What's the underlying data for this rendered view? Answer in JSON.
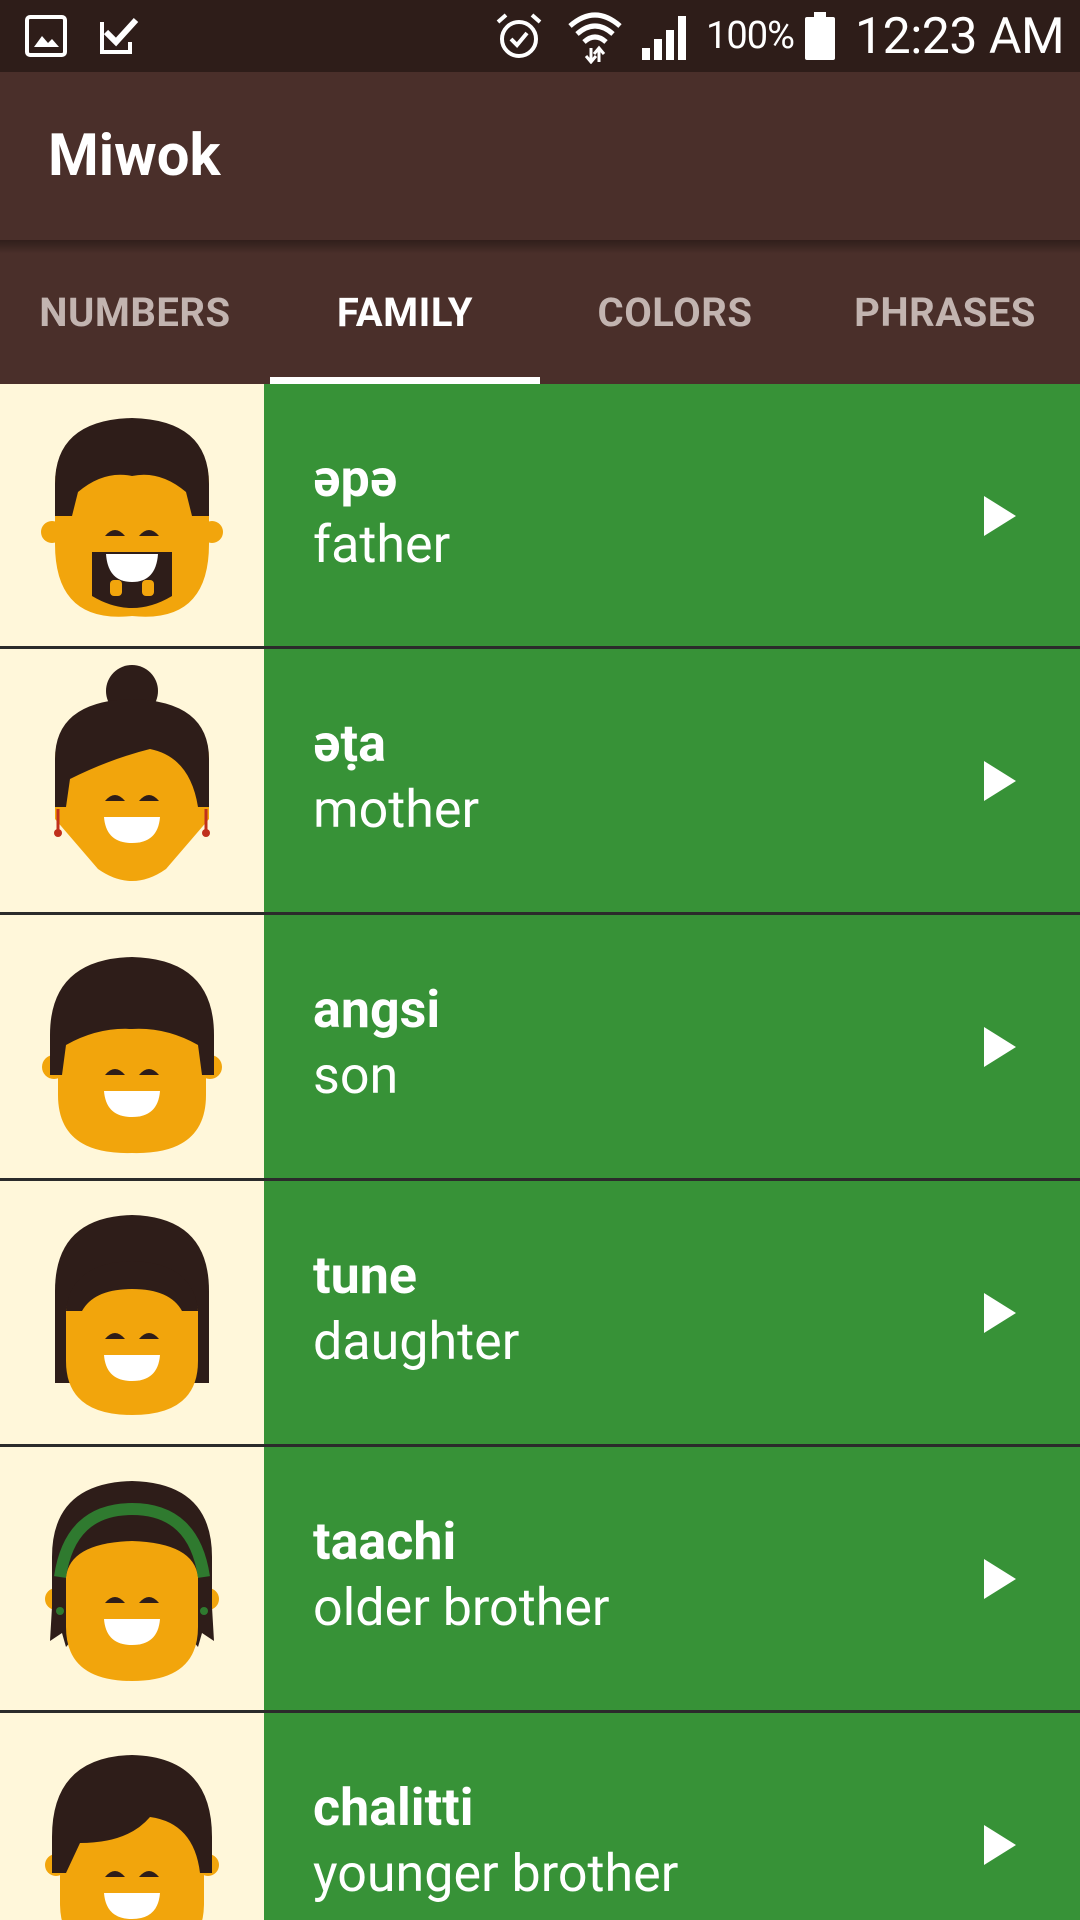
{
  "status_bar": {
    "left_icons": [
      "gallery-icon",
      "task-check-icon"
    ],
    "right_icons": [
      "alarm-icon",
      "wifi-icon",
      "signal-icon",
      "battery-icon"
    ],
    "battery": "100%",
    "time": "12:23 AM"
  },
  "app_bar": {
    "title": "Miwok"
  },
  "tabs": [
    {
      "label": "NUMBERS",
      "selected": false
    },
    {
      "label": "FAMILY",
      "selected": true
    },
    {
      "label": "COLORS",
      "selected": false
    },
    {
      "label": "PHRASES",
      "selected": false
    }
  ],
  "family_list": [
    {
      "miwok": "əpə",
      "english": "father",
      "image": "father-face-icon"
    },
    {
      "miwok": "əṭa",
      "english": "mother",
      "image": "mother-face-icon"
    },
    {
      "miwok": "angsi",
      "english": "son",
      "image": "son-face-icon"
    },
    {
      "miwok": "tune",
      "english": "daughter",
      "image": "daughter-face-icon"
    },
    {
      "miwok": "taachi",
      "english": "older brother",
      "image": "older-brother-face-icon"
    },
    {
      "miwok": "chalitti",
      "english": "younger brother",
      "image": "younger-brother-face-icon"
    }
  ],
  "colors": {
    "status_bar": "#2E1D19",
    "primary": "#4A2F2A",
    "item_background": "#379237",
    "image_background": "#FFF7DA",
    "skin": "#F2A50C",
    "hair": "#2E1D19"
  }
}
